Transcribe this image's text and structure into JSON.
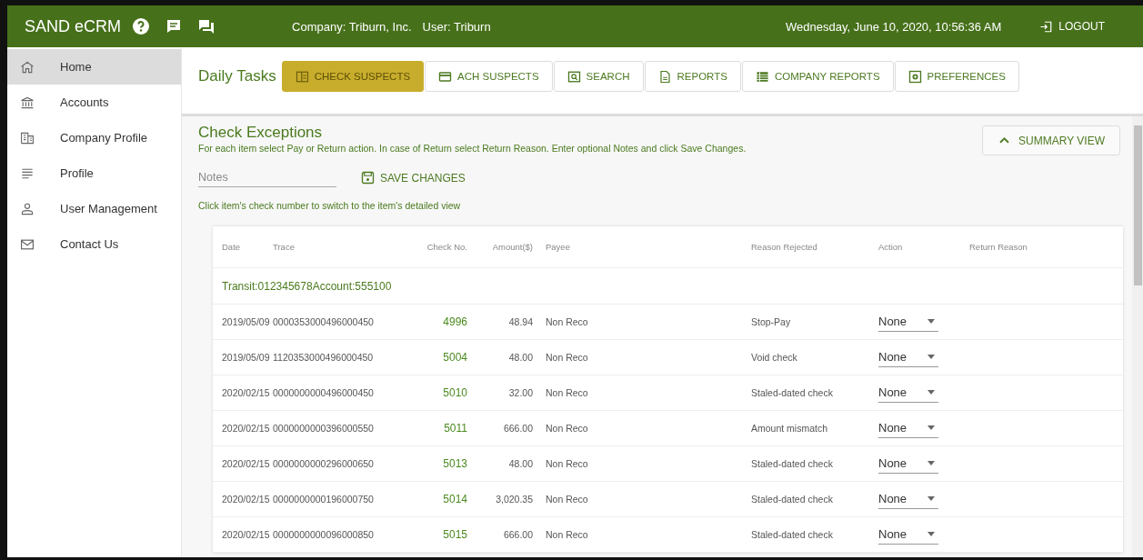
{
  "header": {
    "app_title": "SAND eCRM",
    "company": "Company: Triburn, Inc.",
    "user": "User: Triburn",
    "datetime": "Wednesday, June 10, 2020, 10:56:36 AM",
    "logout": "LOGOUT"
  },
  "sidebar": {
    "items": [
      {
        "label": "Home",
        "selected": true
      },
      {
        "label": "Accounts",
        "selected": false
      },
      {
        "label": "Company Profile",
        "selected": false
      },
      {
        "label": "Profile",
        "selected": false
      },
      {
        "label": "User Management",
        "selected": false
      },
      {
        "label": "Contact Us",
        "selected": false
      }
    ]
  },
  "toolbar": {
    "title": "Daily Tasks",
    "tabs": [
      {
        "label": "CHECK SUSPECTS",
        "selected": true
      },
      {
        "label": "ACH SUSPECTS",
        "selected": false
      },
      {
        "label": "SEARCH",
        "selected": false
      },
      {
        "label": "REPORTS",
        "selected": false
      },
      {
        "label": "COMPANY REPORTS",
        "selected": false
      },
      {
        "label": "PREFERENCES",
        "selected": false
      }
    ]
  },
  "section": {
    "title": "Check Exceptions",
    "description": "For each item select Pay or Return action. In case of Return select Return Reason. Enter optional Notes and click Save Changes.",
    "summary_button": "SUMMARY VIEW",
    "notes": {
      "placeholder": "Notes"
    },
    "save_button": "SAVE CHANGES",
    "hint": "Click item's check number to switch to the item's detailed view"
  },
  "table": {
    "columns": [
      "Date",
      "Trace",
      "Check No.",
      "Amount($)",
      "Payee",
      "Reason Rejected",
      "Action",
      "Return Reason"
    ],
    "group": "Transit:012345678Account:555100",
    "rows": [
      {
        "date": "2019/05/09",
        "trace": "0000353000496000450",
        "check_no": "4996",
        "amount": "48.94",
        "payee": "Non Reco",
        "reason": "Stop-Pay",
        "action": "None"
      },
      {
        "date": "2019/05/09",
        "trace": "1120353000496000450",
        "check_no": "5004",
        "amount": "48.00",
        "payee": "Non Reco",
        "reason": "Void check",
        "action": "None"
      },
      {
        "date": "2020/02/15",
        "trace": "0000000000496000450",
        "check_no": "5010",
        "amount": "32.00",
        "payee": "Non Reco",
        "reason": "Staled-dated check",
        "action": "None"
      },
      {
        "date": "2020/02/15",
        "trace": "0000000000396000550",
        "check_no": "5011",
        "amount": "666.00",
        "payee": "Non Reco",
        "reason": "Amount mismatch",
        "action": "None"
      },
      {
        "date": "2020/02/15",
        "trace": "0000000000296000650",
        "check_no": "5013",
        "amount": "48.00",
        "payee": "Non Reco",
        "reason": "Staled-dated check",
        "action": "None"
      },
      {
        "date": "2020/02/15",
        "trace": "0000000000196000750",
        "check_no": "5014",
        "amount": "3,020.35",
        "payee": "Non Reco",
        "reason": "Staled-dated check",
        "action": "None"
      },
      {
        "date": "2020/02/15",
        "trace": "0000000000096000850",
        "check_no": "5015",
        "amount": "666.00",
        "payee": "Non Reco",
        "reason": "Staled-dated check",
        "action": "None"
      }
    ]
  }
}
